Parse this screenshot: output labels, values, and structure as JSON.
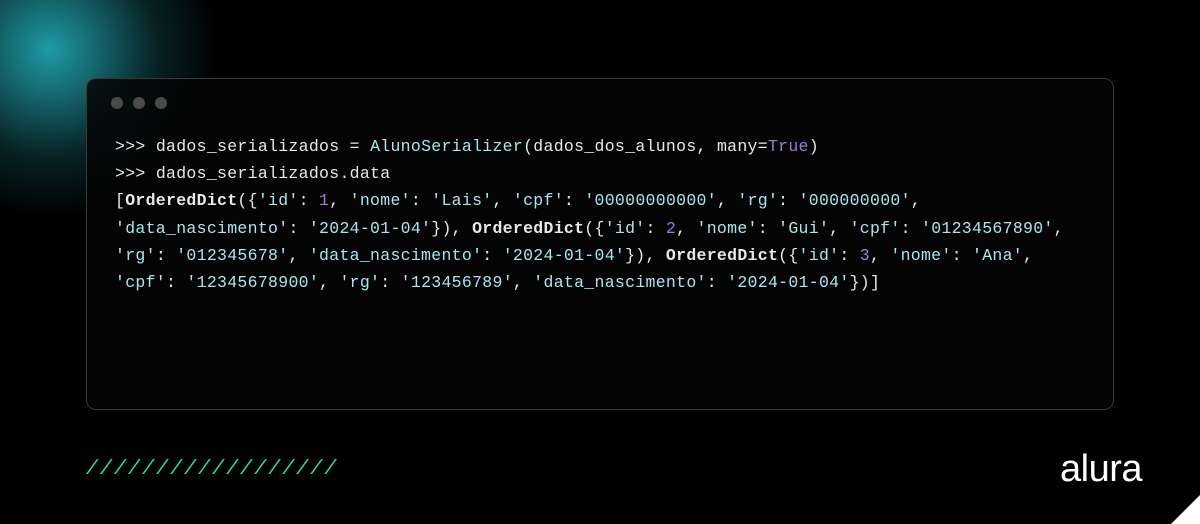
{
  "code": {
    "line1": {
      "prompt": ">>> ",
      "var": "dados_serializados",
      "eq": " = ",
      "cls": "AlunoSerializer",
      "open": "(",
      "arg": "dados_dos_alunos",
      "sep": ", ",
      "kwarg": "many=",
      "true": "True",
      "close": ")"
    },
    "line2": {
      "prompt": ">>> ",
      "expr": "dados_serializados.data"
    },
    "output": {
      "open": "[",
      "od": "OrderedDict",
      "p_open": "({",
      "p_close": "})",
      "close": "]",
      "sep": ", ",
      "colon": ": ",
      "records": [
        {
          "id_key": "'id'",
          "id_val": "1",
          "nome_key": "'nome'",
          "nome_val": "'Lais'",
          "cpf_key": "'cpf'",
          "cpf_val": "'00000000000'",
          "rg_key": "'rg'",
          "rg_val": "'000000000'",
          "dn_key": "'data_nascimento'",
          "dn_val": "'2024-01-04'"
        },
        {
          "id_key": "'id'",
          "id_val": "2",
          "nome_key": "'nome'",
          "nome_val": "'Gui'",
          "cpf_key": "'cpf'",
          "cpf_val": "'01234567890'",
          "rg_key": "'rg'",
          "rg_val": "'012345678'",
          "dn_key": "'data_nascimento'",
          "dn_val": "'2024-01-04'"
        },
        {
          "id_key": "'id'",
          "id_val": "3",
          "nome_key": "'nome'",
          "nome_val": "'Ana'",
          "cpf_key": "'cpf'",
          "cpf_val": "'12345678900'",
          "rg_key": "'rg'",
          "rg_val": "'123456789'",
          "dn_key": "'data_nascimento'",
          "dn_val": "'2024-01-04'"
        }
      ]
    }
  },
  "decor": {
    "slash": "/",
    "slash_count": 18
  },
  "brand": "alura"
}
